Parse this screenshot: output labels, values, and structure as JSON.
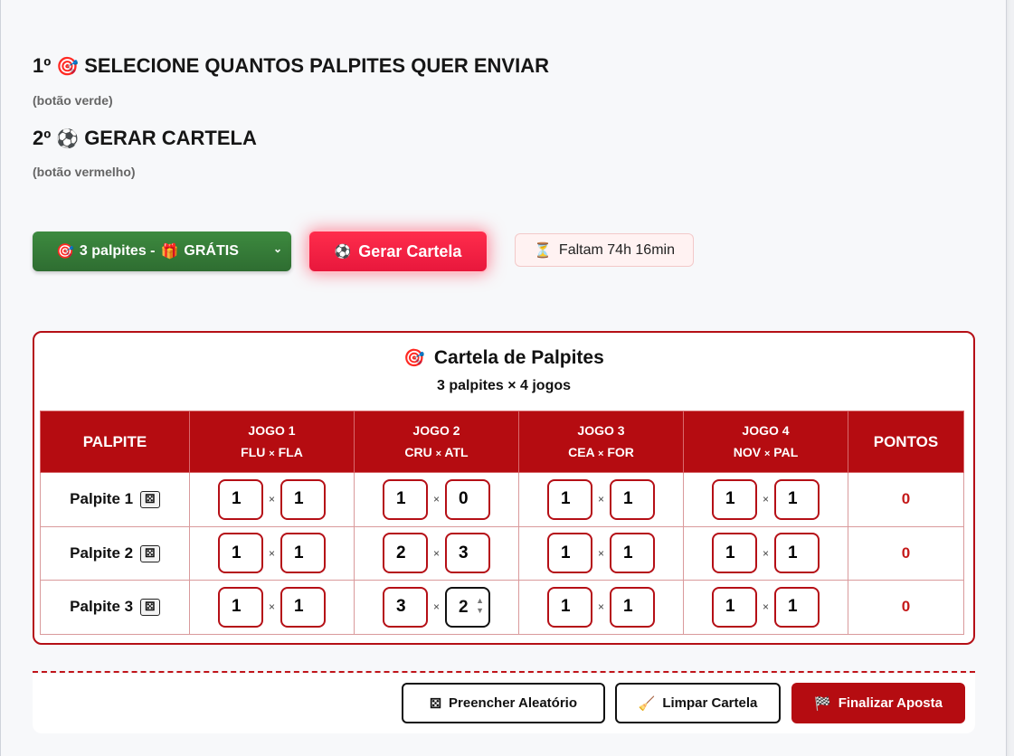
{
  "steps": [
    {
      "number": "1º",
      "icon": "🎯",
      "title": "SELECIONE QUANTOS PALPITES QUER ENVIAR",
      "hint": "(botão verde)"
    },
    {
      "number": "2º",
      "icon": "⚽",
      "title": "GERAR CARTELA",
      "hint": "(botão vermelho)"
    }
  ],
  "controls": {
    "select_icon": "🎯",
    "select_label": "3 palpites -",
    "select_gift": "🎁",
    "select_free": "GRÁTIS",
    "generate_icon": "⚽",
    "generate_label": "Gerar Cartela",
    "timer_icon": "⏳",
    "timer_text": "Faltam 74h 16min"
  },
  "sheet": {
    "icon": "🎯",
    "title": "Cartela de Palpites",
    "subtitle": "3 palpites × 4 jogos",
    "col_palpite": "PALPITE",
    "col_pontos": "PONTOS",
    "games": [
      {
        "label": "JOGO 1",
        "home": "FLU",
        "away": "FLA"
      },
      {
        "label": "JOGO 2",
        "home": "CRU",
        "away": "ATL"
      },
      {
        "label": "JOGO 3",
        "home": "CEA",
        "away": "FOR"
      },
      {
        "label": "JOGO 4",
        "home": "NOV",
        "away": "PAL"
      }
    ],
    "separator": "×",
    "rows": [
      {
        "label": "Palpite 1",
        "scores": [
          [
            "1",
            "1"
          ],
          [
            "1",
            "0"
          ],
          [
            "1",
            "1"
          ],
          [
            "1",
            "1"
          ]
        ],
        "points": "0"
      },
      {
        "label": "Palpite 2",
        "scores": [
          [
            "1",
            "1"
          ],
          [
            "2",
            "3"
          ],
          [
            "1",
            "1"
          ],
          [
            "1",
            "1"
          ]
        ],
        "points": "0"
      },
      {
        "label": "Palpite 3",
        "scores": [
          [
            "1",
            "1"
          ],
          [
            "3",
            "2"
          ],
          [
            "1",
            "1"
          ],
          [
            "1",
            "1"
          ]
        ],
        "points": "0"
      }
    ]
  },
  "footer": {
    "random_icon": "dice-icon",
    "random_label": "Preencher Aleatório",
    "clear_icon": "broom-icon",
    "clear_label": "Limpar Cartela",
    "finish_icon": "🏁",
    "finish_label": "Finalizar Aposta"
  },
  "colors": {
    "primary_red": "#b50c11",
    "green": "#2e6d31",
    "accent_red": "#ff2d4c"
  }
}
